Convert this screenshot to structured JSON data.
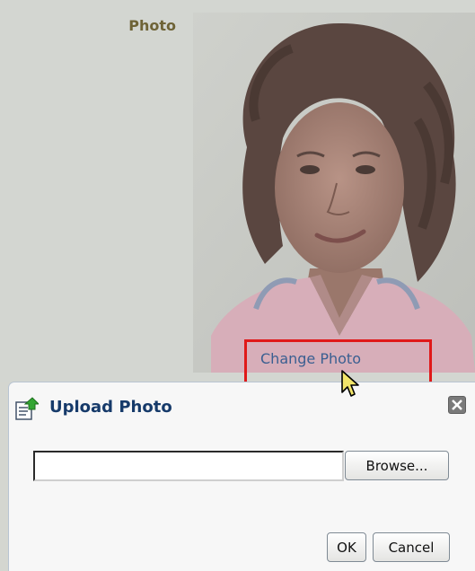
{
  "form": {
    "photo_label": "Photo",
    "change_photo_link": "Change Photo"
  },
  "dialog": {
    "title": "Upload Photo",
    "file_input_value": "",
    "browse_label": "Browse...",
    "ok_label": "OK",
    "cancel_label": "Cancel",
    "icon": "upload-photo-icon",
    "close_icon": "close-icon"
  },
  "colors": {
    "highlight": "#e01919",
    "link": "#3a5f91",
    "dialog_title": "#163a6a",
    "label": "#6e6336"
  }
}
